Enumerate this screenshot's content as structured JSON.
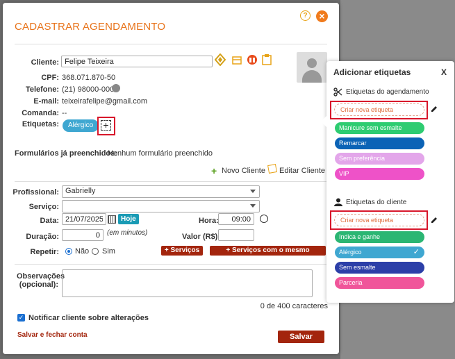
{
  "modal": {
    "title": "CADASTRAR AGENDAMENTO",
    "client": {
      "label": "Cliente:",
      "name": "Felipe Teixeira",
      "cpf_label": "CPF:",
      "cpf": "368.071.870-50",
      "phone_label": "Telefone:",
      "phone": "(21) 98000-0000",
      "email_label": "E-mail:",
      "email": "teixeirafelipe@gmail.com",
      "comanda_label": "Comanda:",
      "comanda": "--",
      "tags_label": "Etiquetas:",
      "tag": "Alérgico"
    },
    "forms_label": "Formulários já preenchidos:",
    "forms_value": "Nenhum formulário preenchido",
    "new_client": "Novo Cliente",
    "edit_client": "Editar Cliente",
    "professional_label": "Profissional:",
    "professional": "Gabrielly",
    "service_label": "Serviço:",
    "service": "",
    "date_label": "Data:",
    "date": "21/07/2025",
    "today": "Hoje",
    "hour_label": "Hora:",
    "hour": "09:00",
    "duration_label": "Duração:",
    "duration": "0",
    "duration_hint": "(em minutos)",
    "price_label": "Valor (R$):",
    "price": "",
    "repeat_label": "Repetir:",
    "repeat_no": "Não",
    "repeat_yes": "Sim",
    "add_services": "+ Serviços",
    "add_same_prof": "+ Serviços com o mesmo profissional",
    "notes_label": "Observações",
    "notes_label2": "(opcional):",
    "char_count": "0 de 400 caracteres",
    "notify": "Notificar cliente sobre alterações",
    "save_close": "Salvar e fechar conta",
    "save": "Salvar"
  },
  "popup": {
    "title": "Adicionar etiquetas",
    "close": "X",
    "appointment_section": "Etiquetas do agendamento",
    "client_section": "Etiquetas do cliente",
    "create_label": "Criar nova etiqueta",
    "appointment_tags": [
      {
        "label": "Manicure sem esmalte",
        "color": "#2ecc71"
      },
      {
        "label": "Remarcar",
        "color": "#0b63b6"
      },
      {
        "label": "Sem preferência",
        "color": "#e3a6ea"
      },
      {
        "label": "VIP",
        "color": "#ee52c8"
      }
    ],
    "client_tags": [
      {
        "label": "Indica e ganhe",
        "color": "#2bb673"
      },
      {
        "label": "Alérgico",
        "color": "#3fa7d1",
        "checked": true
      },
      {
        "label": "Sem esmalte",
        "color": "#2c3fa8"
      },
      {
        "label": "Parceria",
        "color": "#f0559a"
      }
    ]
  },
  "colors": {
    "accent": "#e8731a",
    "button": "#a3250d"
  }
}
